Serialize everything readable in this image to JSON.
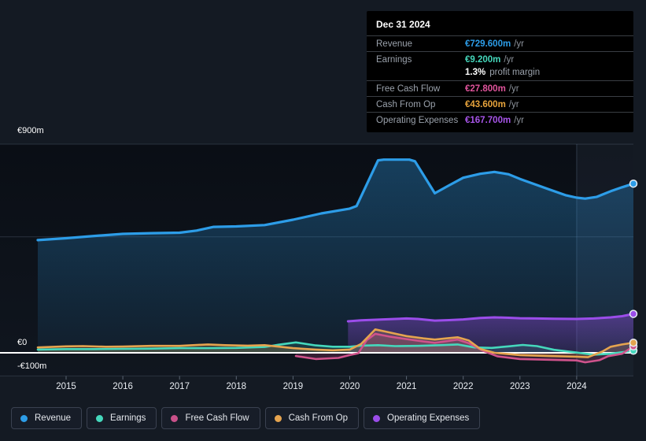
{
  "tooltip": {
    "date": "Dec 31 2024",
    "profit_margin_value": "1.3%",
    "profit_margin_label": "profit margin",
    "rows": [
      {
        "label": "Revenue",
        "value": "€729.600m",
        "suffix": "/yr",
        "color": "#2d9de8"
      },
      {
        "label": "Earnings",
        "value": "€9.200m",
        "suffix": "/yr",
        "color": "#45d8bc"
      },
      {
        "label": "Free Cash Flow",
        "value": "€27.800m",
        "suffix": "/yr",
        "color": "#e0549c"
      },
      {
        "label": "Cash From Op",
        "value": "€43.600m",
        "suffix": "/yr",
        "color": "#e8a43c"
      },
      {
        "label": "Operating Expenses",
        "value": "€167.700m",
        "suffix": "/yr",
        "color": "#a855ea"
      }
    ]
  },
  "y_axis": {
    "top": "€900m",
    "zero": "€0",
    "bottom": "-€100m"
  },
  "x_axis": {
    "years": [
      "2015",
      "2016",
      "2017",
      "2018",
      "2019",
      "2020",
      "2021",
      "2022",
      "2023",
      "2024"
    ]
  },
  "legend": {
    "items": [
      {
        "label": "Revenue",
        "color": "#2d9de8"
      },
      {
        "label": "Earnings",
        "color": "#45d8bc"
      },
      {
        "label": "Free Cash Flow",
        "color": "#c9518a"
      },
      {
        "label": "Cash From Op",
        "color": "#e5a44f"
      },
      {
        "label": "Operating Expenses",
        "color": "#9b4dea"
      }
    ]
  },
  "chart_data": {
    "type": "area",
    "unit": "€m",
    "x_range": [
      2014.5,
      2025
    ],
    "ylim": [
      -100,
      900
    ],
    "gridlines": [
      {
        "value": 900
      },
      {
        "value": 500
      },
      {
        "value": 0
      },
      {
        "value": -100
      }
    ],
    "highlight_from": 2024,
    "highlight_to": 2025,
    "legend_position": "bottom",
    "series": [
      {
        "key": "revenue",
        "name": "Revenue",
        "color": "#2d9de8",
        "width": 3.2,
        "area": "blue-gradient",
        "points": [
          [
            2014.5,
            486
          ],
          [
            2015,
            494
          ],
          [
            2015.5,
            504
          ],
          [
            2016,
            513
          ],
          [
            2016.5,
            516
          ],
          [
            2017,
            518
          ],
          [
            2017.3,
            527
          ],
          [
            2017.6,
            543
          ],
          [
            2018,
            545
          ],
          [
            2018.5,
            551
          ],
          [
            2019,
            574
          ],
          [
            2019.5,
            601
          ],
          [
            2020,
            622
          ],
          [
            2020.12,
            633
          ],
          [
            2020.5,
            830
          ],
          [
            2020.6,
            833
          ],
          [
            2021.05,
            833
          ],
          [
            2021.15,
            826
          ],
          [
            2021.5,
            688
          ],
          [
            2021.75,
            722
          ],
          [
            2022,
            755
          ],
          [
            2022.3,
            772
          ],
          [
            2022.55,
            780
          ],
          [
            2022.8,
            770
          ],
          [
            2023,
            750
          ],
          [
            2023.5,
            706
          ],
          [
            2023.8,
            680
          ],
          [
            2024,
            669
          ],
          [
            2024.15,
            665
          ],
          [
            2024.35,
            672
          ],
          [
            2024.6,
            697
          ],
          [
            2024.8,
            714
          ],
          [
            2025,
            729.6
          ]
        ]
      },
      {
        "key": "opex",
        "name": "Operating Expenses",
        "color": "#9b4dea",
        "width": 3,
        "area": "purple-gradient",
        "points": [
          [
            2019.97,
            136
          ],
          [
            2020.2,
            140
          ],
          [
            2020.5,
            143
          ],
          [
            2020.8,
            146
          ],
          [
            2021,
            148
          ],
          [
            2021.2,
            146
          ],
          [
            2021.5,
            139
          ],
          [
            2021.75,
            141
          ],
          [
            2022,
            144
          ],
          [
            2022.3,
            150
          ],
          [
            2022.55,
            153
          ],
          [
            2022.8,
            151
          ],
          [
            2023,
            149
          ],
          [
            2023.3,
            148
          ],
          [
            2023.6,
            147
          ],
          [
            2024,
            146
          ],
          [
            2024.3,
            148
          ],
          [
            2024.6,
            153
          ],
          [
            2024.8,
            158
          ],
          [
            2025,
            167.7
          ]
        ]
      },
      {
        "key": "earnings",
        "name": "Earnings",
        "color": "#45d8bc",
        "width": 2.6,
        "area": "rgba(80,220,190,0.14)",
        "points": [
          [
            2014.5,
            14
          ],
          [
            2015,
            16
          ],
          [
            2015.5,
            16
          ],
          [
            2016,
            17
          ],
          [
            2016.5,
            18
          ],
          [
            2017,
            20
          ],
          [
            2017.5,
            20
          ],
          [
            2018,
            21
          ],
          [
            2018.5,
            25
          ],
          [
            2018.75,
            35
          ],
          [
            2019.05,
            45
          ],
          [
            2019.4,
            32
          ],
          [
            2019.7,
            26
          ],
          [
            2020,
            26
          ],
          [
            2020.2,
            31
          ],
          [
            2020.5,
            33
          ],
          [
            2020.8,
            29
          ],
          [
            2021.2,
            30
          ],
          [
            2021.6,
            33
          ],
          [
            2021.9,
            36
          ],
          [
            2022.2,
            23
          ],
          [
            2022.5,
            21
          ],
          [
            2022.8,
            28
          ],
          [
            2023.05,
            34
          ],
          [
            2023.3,
            29
          ],
          [
            2023.6,
            13
          ],
          [
            2024,
            1
          ],
          [
            2024.3,
            -8
          ],
          [
            2024.6,
            -4
          ],
          [
            2025,
            9.2
          ]
        ]
      },
      {
        "key": "fcf",
        "name": "Free Cash Flow",
        "color": "#d0538c",
        "width": 2.6,
        "area": "rgba(215,80,145,0.20)",
        "points": [
          [
            2019.05,
            -14
          ],
          [
            2019.4,
            -27
          ],
          [
            2019.8,
            -22
          ],
          [
            2020,
            -10
          ],
          [
            2020.15,
            -2
          ],
          [
            2020.3,
            55
          ],
          [
            2020.45,
            82
          ],
          [
            2020.7,
            70
          ],
          [
            2021,
            59
          ],
          [
            2021.3,
            49
          ],
          [
            2021.5,
            43
          ],
          [
            2021.7,
            50
          ],
          [
            2021.9,
            57
          ],
          [
            2022.1,
            41
          ],
          [
            2022.35,
            9
          ],
          [
            2022.6,
            -15
          ],
          [
            2023,
            -27
          ],
          [
            2023.5,
            -30
          ],
          [
            2024,
            -33
          ],
          [
            2024.15,
            -41
          ],
          [
            2024.4,
            -32
          ],
          [
            2024.55,
            -15
          ],
          [
            2024.8,
            -4
          ],
          [
            2025,
            27.8
          ]
        ]
      },
      {
        "key": "cashop",
        "name": "Cash From Op",
        "color": "#e5a44f",
        "width": 2.6,
        "area": "rgba(230,165,80,0.20)",
        "points": [
          [
            2014.5,
            23
          ],
          [
            2015,
            28
          ],
          [
            2015.3,
            29
          ],
          [
            2015.7,
            26
          ],
          [
            2016,
            27
          ],
          [
            2016.5,
            30
          ],
          [
            2017,
            30
          ],
          [
            2017.5,
            36
          ],
          [
            2017.8,
            33
          ],
          [
            2018.2,
            31
          ],
          [
            2018.5,
            33
          ],
          [
            2019,
            20
          ],
          [
            2019.4,
            14
          ],
          [
            2019.7,
            11
          ],
          [
            2020,
            14
          ],
          [
            2020.2,
            38
          ],
          [
            2020.45,
            101
          ],
          [
            2020.7,
            88
          ],
          [
            2021,
            72
          ],
          [
            2021.3,
            62
          ],
          [
            2021.5,
            57
          ],
          [
            2021.7,
            62
          ],
          [
            2021.9,
            67
          ],
          [
            2022.1,
            53
          ],
          [
            2022.3,
            17
          ],
          [
            2022.55,
            0
          ],
          [
            2023,
            -10
          ],
          [
            2023.5,
            -14
          ],
          [
            2024,
            -17
          ],
          [
            2024.2,
            -19
          ],
          [
            2024.45,
            5
          ],
          [
            2024.6,
            26
          ],
          [
            2024.8,
            36
          ],
          [
            2025,
            43.6
          ]
        ]
      }
    ]
  }
}
